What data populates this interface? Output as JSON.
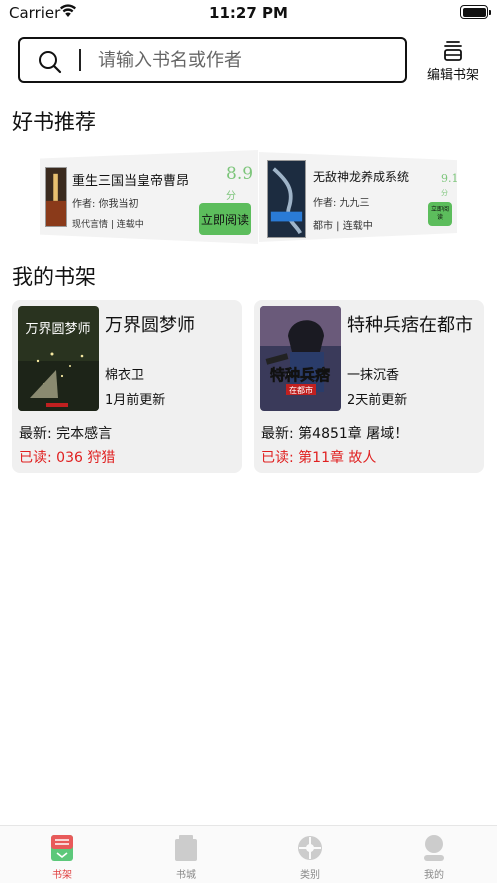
{
  "status_bar": {
    "carrier": "Carrier",
    "time": "11:27 PM"
  },
  "search": {
    "placeholder": "请输入书名或作者"
  },
  "header": {
    "edit_shelf_label": "编辑书架"
  },
  "sections": {
    "recommend_title": "好书推荐",
    "shelf_title": "我的书架"
  },
  "recommend": [
    {
      "title": "重生三国当皇帝曹昂",
      "author": "作者: 你我当初",
      "tags": "现代言情 | 连载中",
      "score": "8.9",
      "score_unit": "分",
      "read_button": "立即阅读"
    },
    {
      "title": "无敌神龙养成系统",
      "author": "作者: 九九三",
      "tags": "都市 | 连载中",
      "score": "9.1",
      "score_unit": "分",
      "read_button": "立即阅读"
    }
  ],
  "shelf": [
    {
      "title": "万界圆梦师",
      "cover_text": "万界圆梦师",
      "author": "棉衣卫",
      "update": "1月前更新",
      "latest": "最新:  完本感言",
      "read": "已读:  036 狩猎"
    },
    {
      "title": "特种兵痞在都市",
      "cover_text": "特种兵痞",
      "cover_subtext": "在都市",
      "author": "一抹沉香",
      "update": "2天前更新",
      "latest": "最新:  第4851章 屠域！",
      "read": "已读:  第11章 故人"
    }
  ],
  "tabs": [
    {
      "label": "书架",
      "icon": "bookshelf-icon",
      "active": true
    },
    {
      "label": "书城",
      "icon": "bookstore-icon",
      "active": false
    },
    {
      "label": "类别",
      "icon": "category-icon",
      "active": false
    },
    {
      "label": "我的",
      "icon": "profile-icon",
      "active": false
    }
  ],
  "colors": {
    "accent_green": "#5cbd5c",
    "score_green": "#7cc57a",
    "read_red": "#e02020",
    "active_tab_red": "#e04040"
  }
}
